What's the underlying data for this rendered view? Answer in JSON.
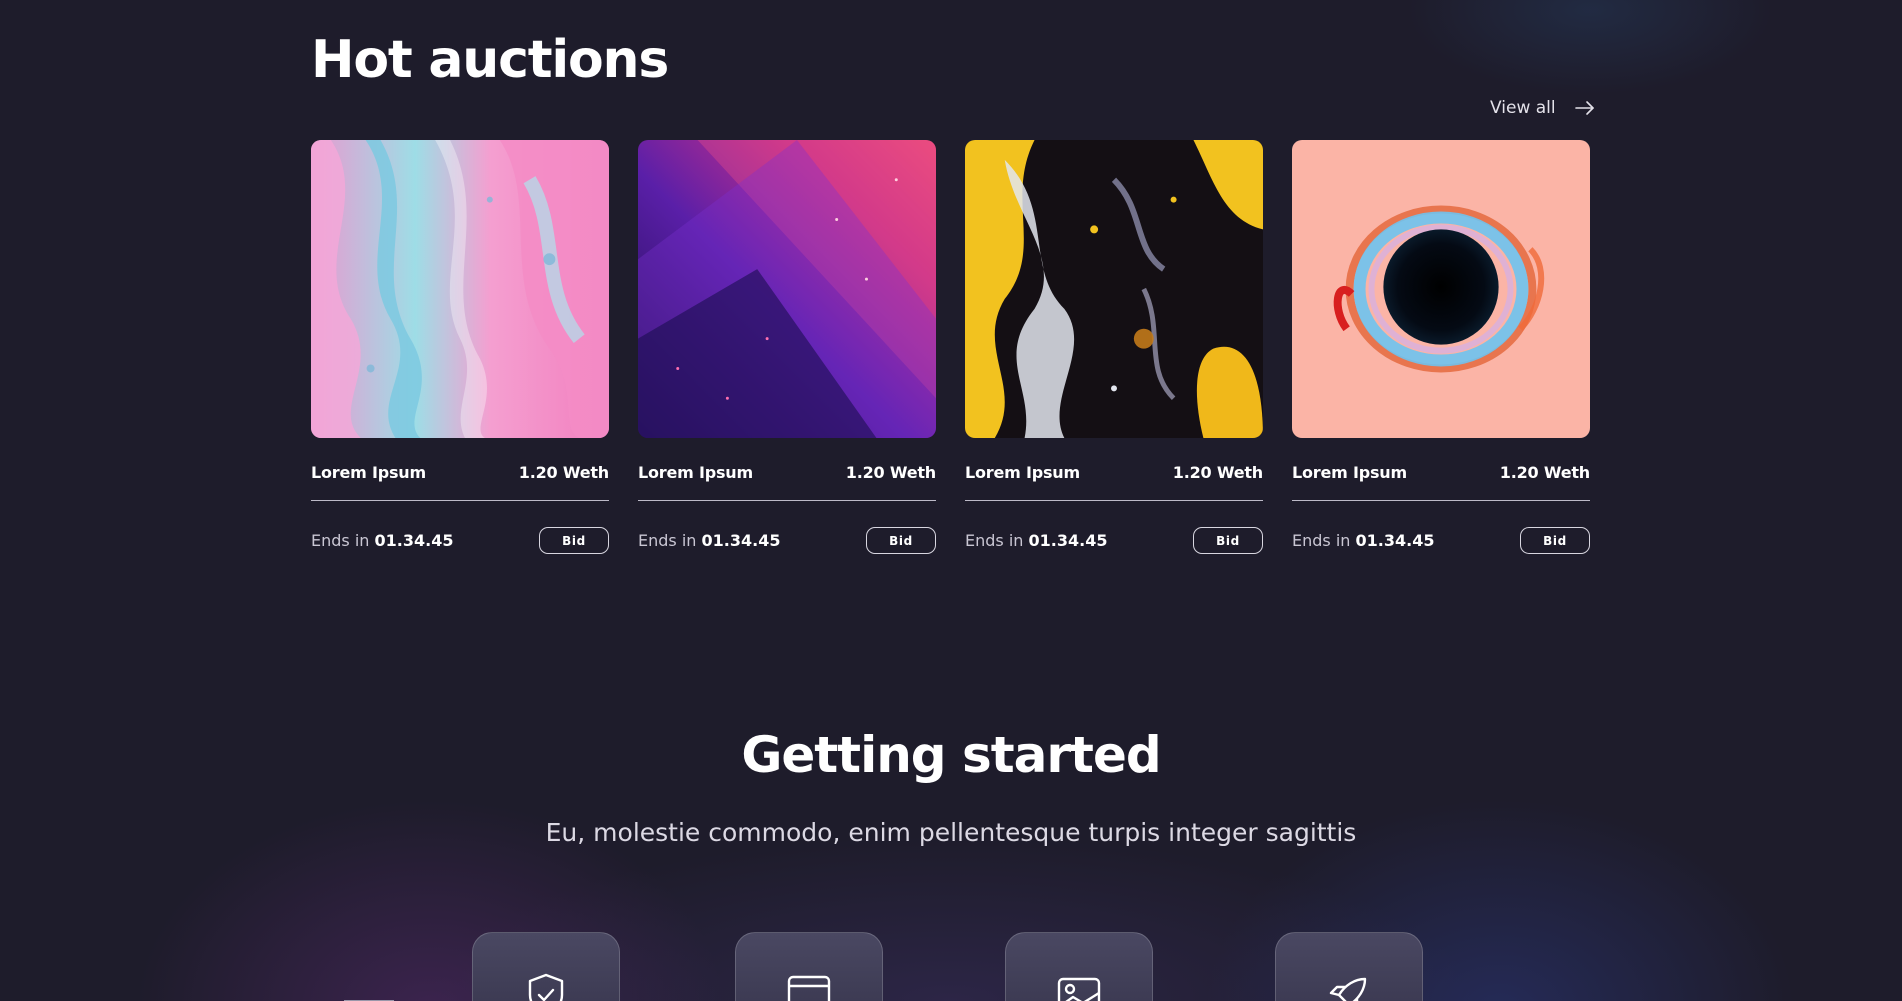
{
  "auctions": {
    "title": "Hot auctions",
    "view_all_label": "View all",
    "cards": [
      {
        "name": "Lorem Ipsum",
        "price": "1.20 Weth",
        "ends_label": "Ends in",
        "time": "01.34.45",
        "bid_label": "Bid",
        "art": "pastel-marble-art"
      },
      {
        "name": "Lorem Ipsum",
        "price": "1.20 Weth",
        "ends_label": "Ends in",
        "time": "01.34.45",
        "bid_label": "Bid",
        "art": "purple-pink-glass-art"
      },
      {
        "name": "Lorem Ipsum",
        "price": "1.20 Weth",
        "ends_label": "Ends in",
        "time": "01.34.45",
        "bid_label": "Bid",
        "art": "yellow-black-fluid-art"
      },
      {
        "name": "Lorem Ipsum",
        "price": "1.20 Weth",
        "ends_label": "Ends in",
        "time": "01.34.45",
        "bid_label": "Bid",
        "art": "black-hole-swirl-art"
      }
    ]
  },
  "getting_started": {
    "title": "Getting started",
    "subtitle": "Eu, molestie commodo, enim pellentesque turpis integer sagittis",
    "steps": [
      {
        "icon": "shield-check-icon"
      },
      {
        "icon": "wallet-card-icon"
      },
      {
        "icon": "image-icon"
      },
      {
        "icon": "rocket-icon"
      }
    ]
  },
  "colors": {
    "background": "#1e1c2b",
    "text": "#ffffff",
    "muted_text": "#c9c6d3",
    "divider": "#bdbac8"
  }
}
